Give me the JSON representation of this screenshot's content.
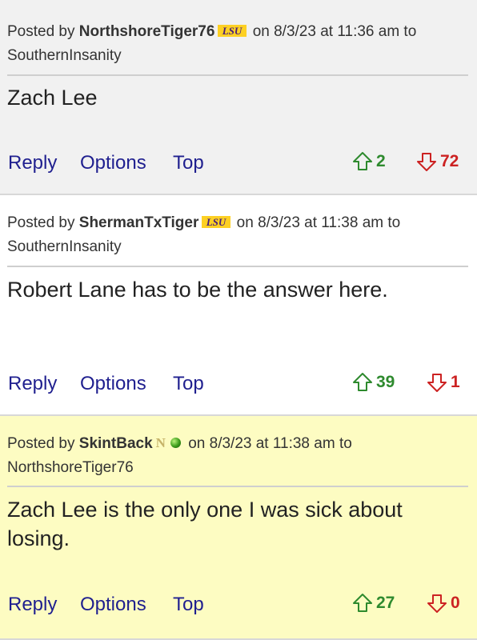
{
  "posts": [
    {
      "posted_by_label": "Posted by",
      "author": "NorthshoreTiger76",
      "badge": "LSU",
      "date_text": "on 8/3/23 at 11:36 am to",
      "reply_to": "SouthernInsanity",
      "body": "Zach Lee",
      "reply_label": "Reply",
      "options_label": "Options",
      "top_label": "Top",
      "upvotes": "2",
      "downvotes": "72",
      "bg": "#f1f1f1"
    },
    {
      "posted_by_label": "Posted by",
      "author": "ShermanTxTiger",
      "badge": "LSU",
      "date_text": "on 8/3/23 at 11:38 am to",
      "reply_to": "SouthernInsanity",
      "body": "Robert Lane has to be the answer here.",
      "reply_label": "Reply",
      "options_label": "Options",
      "top_label": "Top",
      "upvotes": "39",
      "downvotes": "1",
      "bg": "#ffffff"
    },
    {
      "posted_by_label": "Posted by",
      "author": "SkintBack",
      "badge": "N",
      "date_text": "on 8/3/23 at 11:38 am to",
      "reply_to": "NorthshoreTiger76",
      "body": "Zach Lee is the only one I was sick about losing.",
      "reply_label": "Reply",
      "options_label": "Options",
      "top_label": "Top",
      "upvotes": "27",
      "downvotes": "0",
      "bg": "#fdfcc2"
    }
  ],
  "colors": {
    "link": "#1f1f8f",
    "upvote": "#2e8a2e",
    "downvote": "#cc2222",
    "lsu_purple": "#461d7c",
    "lsu_gold": "#fdd023"
  }
}
